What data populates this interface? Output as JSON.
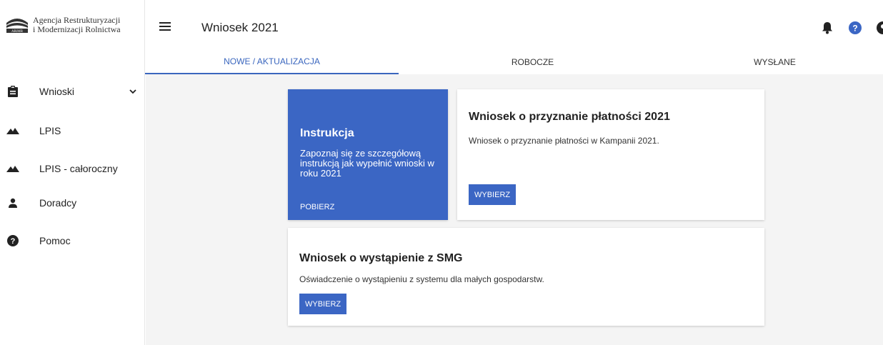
{
  "logo": {
    "line1": "Agencja Restrukturyzacji",
    "line2": "i Modernizacji Rolnictwa",
    "mark_text": "ARiMR"
  },
  "sidebar": {
    "items": [
      {
        "label": "Wnioski",
        "icon": "clipboard-icon"
      },
      {
        "label": "LPIS",
        "icon": "terrain-icon"
      },
      {
        "label": "LPIS - całoroczny",
        "icon": "terrain-icon"
      },
      {
        "label": "Doradcy",
        "icon": "person-icon"
      },
      {
        "label": "Pomoc",
        "icon": "help-icon"
      }
    ]
  },
  "header": {
    "title": "Wniosek 2021",
    "icons": [
      "bell-icon",
      "help-circle-icon",
      "account-icon"
    ]
  },
  "tabs": [
    {
      "label": "NOWE / AKTUALIZACJA",
      "active": true
    },
    {
      "label": "ROBOCZE",
      "active": false
    },
    {
      "label": "WYSŁANE",
      "active": false
    }
  ],
  "cards": {
    "instruction": {
      "title": "Instrukcja",
      "text": "Zapoznaj się ze szczegółową instrukcją jak wypełnić wnioski w roku 2021",
      "link": "POBIERZ"
    },
    "payment": {
      "title": "Wniosek o przyznanie płatności 2021",
      "description": "Wniosek o przyznanie płatności w Kampanii 2021.",
      "button": "WYBIERZ"
    },
    "smg": {
      "title": "Wniosek o wystąpienie z SMG",
      "description": "Oświadczenie o wystąpieniu z systemu dla małych gospodarstw.",
      "button": "WYBIERZ"
    }
  },
  "colors": {
    "accent": "#3b66c4",
    "content_bg": "#f4f4f4"
  }
}
